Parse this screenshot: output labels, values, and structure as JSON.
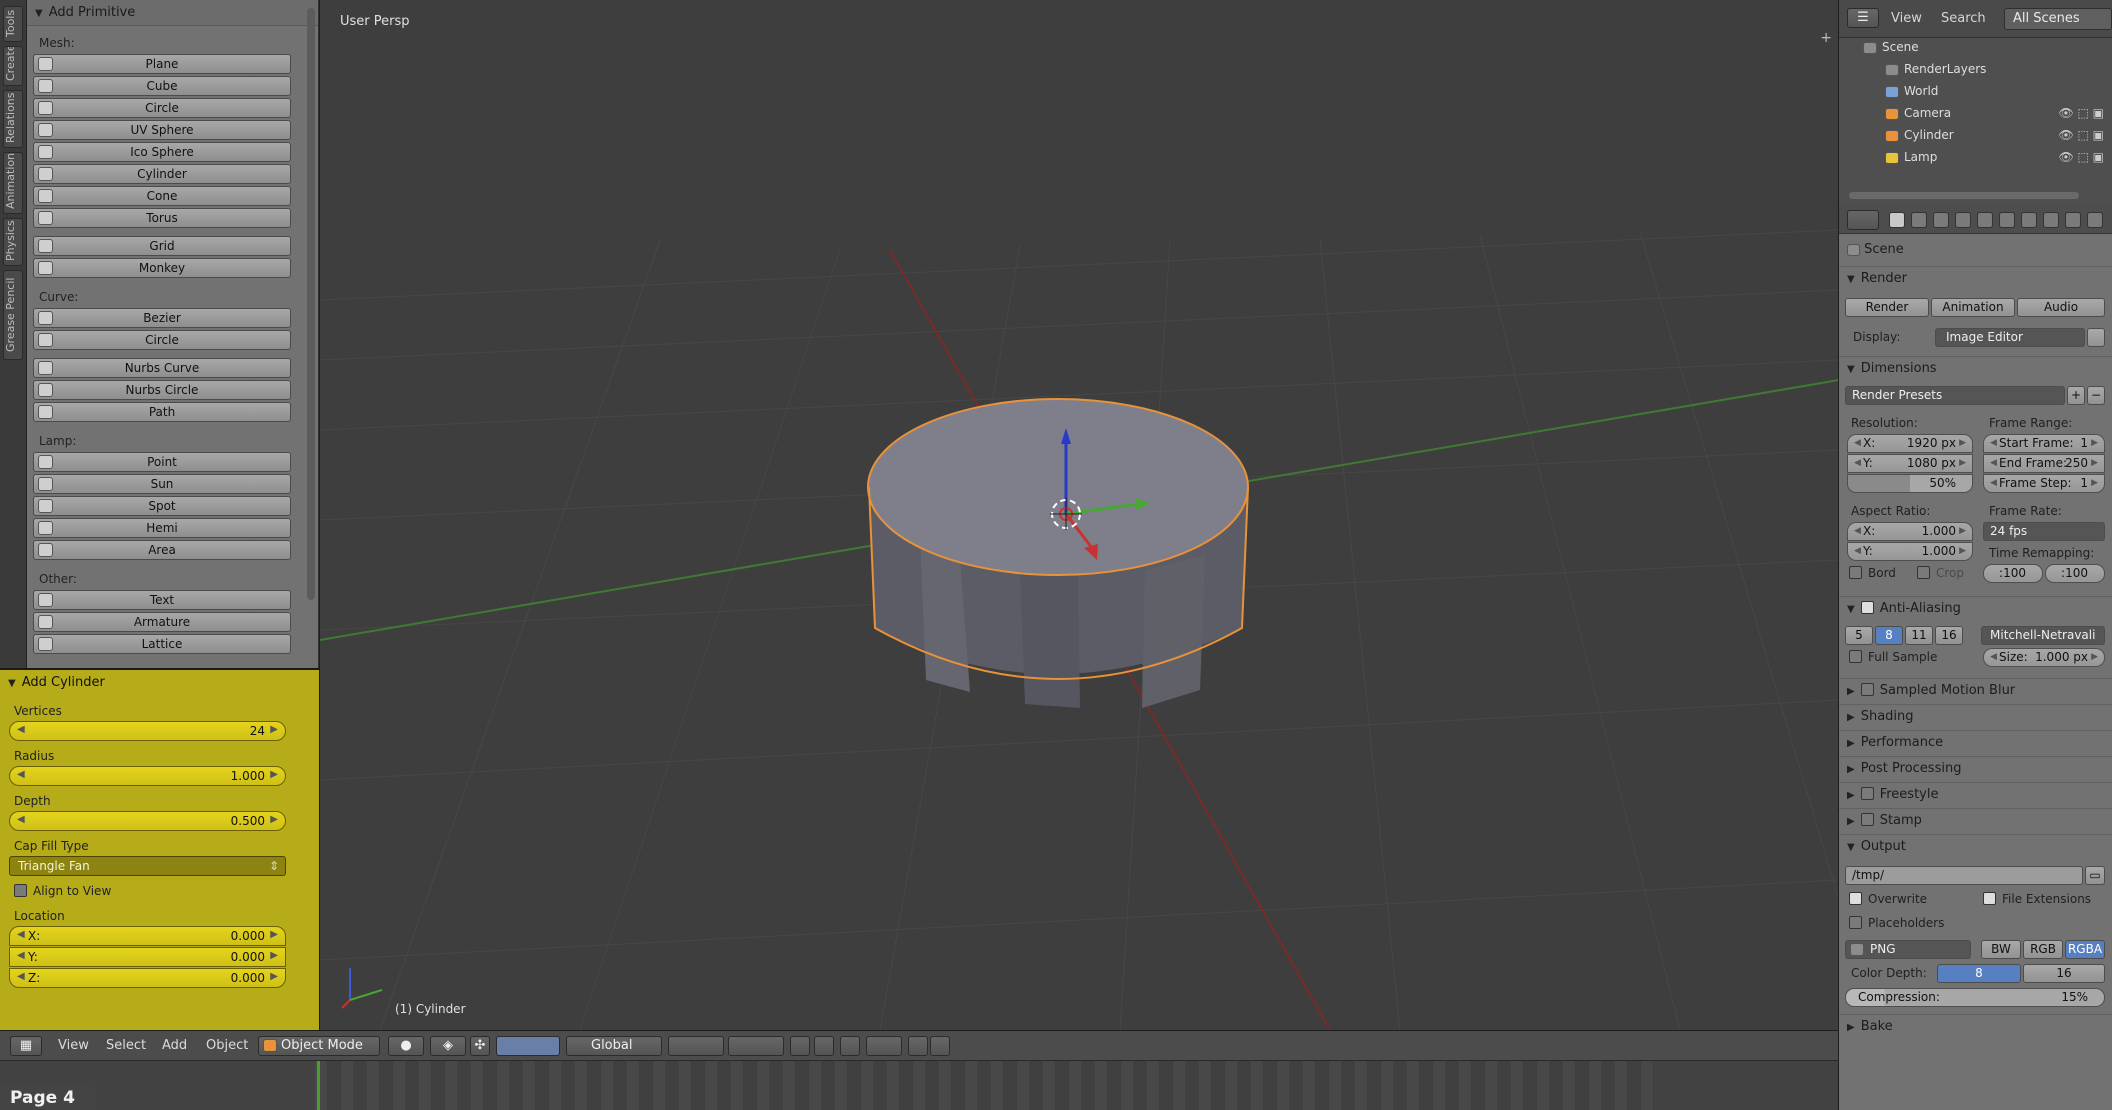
{
  "tool_tabs": [
    "Tools",
    "Create",
    "Relations",
    "Animation",
    "Physics",
    "Grease Pencil"
  ],
  "toolshelf": {
    "header": "Add Primitive",
    "mesh_label": "Mesh:",
    "mesh_items": [
      "Plane",
      "Cube",
      "Circle",
      "UV Sphere",
      "Ico Sphere",
      "Cylinder",
      "Cone",
      "Torus"
    ],
    "mesh_items2": [
      "Grid",
      "Monkey"
    ],
    "curve_label": "Curve:",
    "curve_items": [
      "Bezier",
      "Circle"
    ],
    "curve_items2": [
      "Nurbs Curve",
      "Nurbs Circle",
      "Path"
    ],
    "lamp_label": "Lamp:",
    "lamp_items": [
      "Point",
      "Sun",
      "Spot",
      "Hemi",
      "Area"
    ],
    "other_label": "Other:",
    "other_items": [
      "Text",
      "Armature",
      "Lattice"
    ]
  },
  "operator": {
    "title": "Add Cylinder",
    "vertices_label": "Vertices",
    "vertices": "24",
    "radius_label": "Radius",
    "radius": "1.000",
    "depth_label": "Depth",
    "depth": "0.500",
    "cap_label": "Cap Fill Type",
    "cap_value": "Triangle Fan",
    "align_label": "Align to View",
    "align_checked": false,
    "location_label": "Location",
    "loc_x_label": "X:",
    "loc_x": "0.000",
    "loc_y_label": "Y:",
    "loc_y": "0.000",
    "loc_z_label": "Z:",
    "loc_z": "0.000"
  },
  "viewport": {
    "view_label": "User Persp",
    "object_label": "(1) Cylinder",
    "colors": {
      "background": "#3e3e3e",
      "selection_outline": "#e8923a",
      "x_axis": "#c83232",
      "y_axis": "#46a832",
      "z_axis": "#2a3ac8"
    }
  },
  "header3d": {
    "menu": [
      "View",
      "Select",
      "Add",
      "Object"
    ],
    "mode": "Object Mode",
    "orientation": "Global"
  },
  "page_label": "Page 4",
  "outliner": {
    "menu": [
      "View",
      "Search"
    ],
    "scenes": "All Scenes",
    "items": [
      "Scene",
      "RenderLayers",
      "World",
      "Camera",
      "Cylinder",
      "Lamp"
    ]
  },
  "properties": {
    "context": "Scene",
    "render_header": "Render",
    "render_btn": "Render",
    "animation_btn": "Animation",
    "audio_btn": "Audio",
    "display_label": "Display:",
    "display_value": "Image Editor",
    "dimensions_header": "Dimensions",
    "presets": "Render Presets",
    "resolution_label": "Resolution:",
    "res_x_label": "X:",
    "res_x": "1920 px",
    "res_y_label": "Y:",
    "res_y": "1080 px",
    "res_pct": "50%",
    "frame_range_label": "Frame Range:",
    "start_label": "Start Frame:",
    "start": "1",
    "end_label": "End Frame:",
    "end": "250",
    "step_label": "Frame Step:",
    "step": "1",
    "aspect_label": "Aspect Ratio:",
    "asp_x_label": "X:",
    "asp_x": "1.000",
    "asp_y_label": "Y:",
    "asp_y": "1.000",
    "frame_rate_label": "Frame Rate:",
    "frame_rate": "24 fps",
    "border_label": "Bord",
    "crop_label": "Crop",
    "time_remap_label": "Time Remapping:",
    "remap_old": ":100",
    "remap_new": ":100",
    "aa_header": "Anti-Aliasing",
    "aa_samples": [
      "5",
      "8",
      "11",
      "16"
    ],
    "aa_selected": "8",
    "aa_filter": "Mitchell-Netravali",
    "full_sample": "Full Sample",
    "size_label": "Size:",
    "size_value": "1.000 px",
    "motion_blur": "Sampled Motion Blur",
    "shading": "Shading",
    "performance": "Performance",
    "post_processing": "Post Processing",
    "freestyle": "Freestyle",
    "stamp": "Stamp",
    "output_header": "Output",
    "output_path": "/tmp/",
    "overwrite": "Overwrite",
    "file_extensions": "File Extensions",
    "placeholders": "Placeholders",
    "format": "PNG",
    "color_modes": [
      "BW",
      "RGB",
      "RGBA"
    ],
    "color_selected": "RGBA",
    "color_depth_label": "Color Depth:",
    "depth_8": "8",
    "depth_16": "16",
    "compression_label": "Compression:",
    "compression": "15%",
    "bake": "Bake"
  }
}
